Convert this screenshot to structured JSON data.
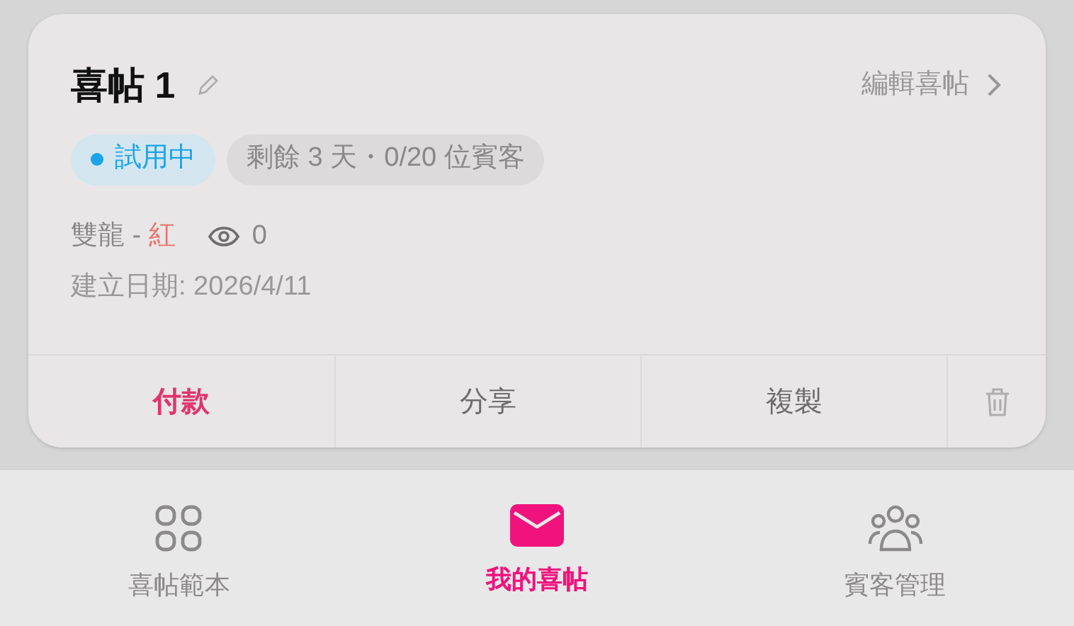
{
  "card": {
    "title": "喜帖 1",
    "edit_link": "編輯喜帖",
    "status": {
      "label": "試用中",
      "color": "#1aa3e8"
    },
    "quota": "剩餘 3 天・0/20 位賓客",
    "theme": {
      "name": "雙龍 - ",
      "variant": "紅"
    },
    "views": "0",
    "created": "建立日期: 2026/4/11",
    "actions": [
      {
        "label": "付款",
        "kind": "primary"
      },
      {
        "label": "分享",
        "kind": "normal"
      },
      {
        "label": "複製",
        "kind": "normal"
      },
      {
        "kind": "delete"
      }
    ]
  },
  "tabs": [
    {
      "label": "喜帖範本",
      "kind": "grid",
      "selected": false
    },
    {
      "label": "我的喜帖",
      "kind": "mail",
      "selected": true
    },
    {
      "label": "賓客管理",
      "kind": "people",
      "selected": false
    }
  ]
}
